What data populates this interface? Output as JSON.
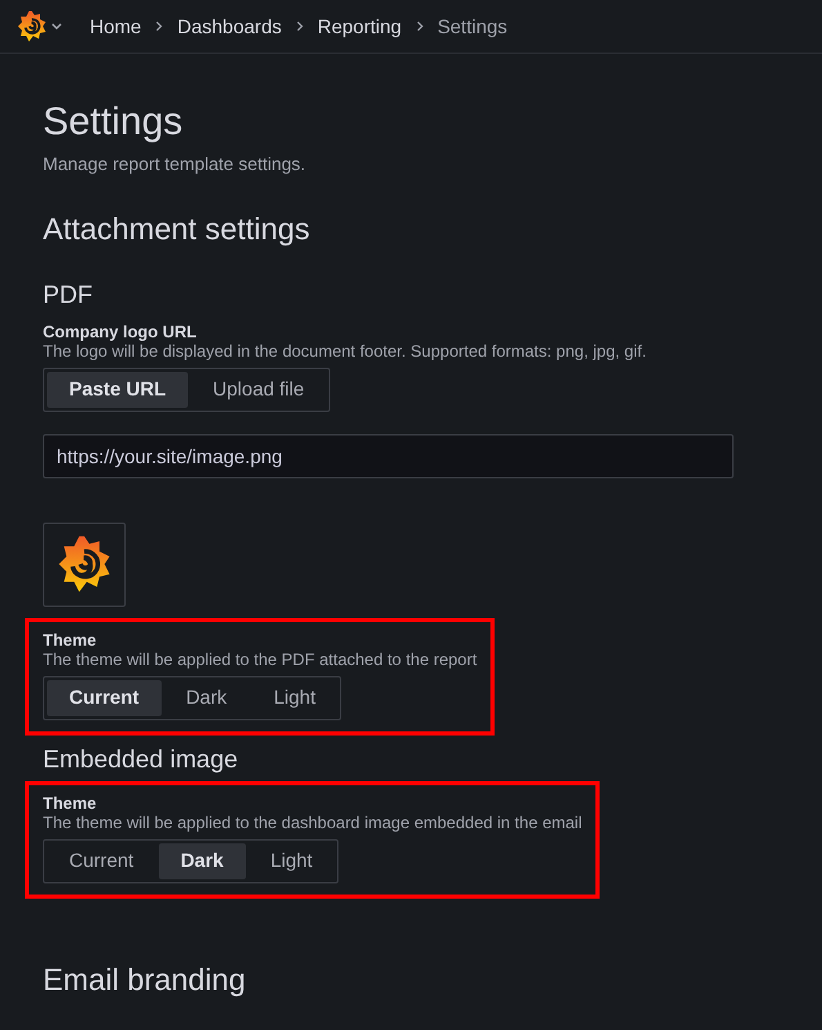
{
  "breadcrumbs": [
    {
      "label": "Home",
      "current": false
    },
    {
      "label": "Dashboards",
      "current": false
    },
    {
      "label": "Reporting",
      "current": false
    },
    {
      "label": "Settings",
      "current": true
    }
  ],
  "page": {
    "title": "Settings",
    "subtitle": "Manage report template settings."
  },
  "sections": [
    {
      "heading": "Attachment settings",
      "subheading": "PDF",
      "fields": [
        {
          "kind": "logo",
          "label": "Company logo URL",
          "description": "The logo will be displayed in the document footer. Supported formats: png, jpg, gif.",
          "options": [
            {
              "label": "Paste URL",
              "selected": true
            },
            {
              "label": "Upload file",
              "selected": false
            }
          ],
          "input": {
            "value": "https://your.site/image.png"
          }
        },
        {
          "kind": "theme",
          "highlighted": true,
          "label": "Theme",
          "description": "The theme will be applied to the PDF attached to the report",
          "options": [
            {
              "label": "Current",
              "selected": true
            },
            {
              "label": "Dark",
              "selected": false
            },
            {
              "label": "Light",
              "selected": false
            }
          ]
        }
      ]
    },
    {
      "subheading_large": "Embedded image",
      "fields": [
        {
          "kind": "theme",
          "highlighted": true,
          "label": "Theme",
          "description": "The theme will be applied to the dashboard image embedded in the email",
          "options": [
            {
              "label": "Current",
              "selected": false
            },
            {
              "label": "Dark",
              "selected": true
            },
            {
              "label": "Light",
              "selected": false
            }
          ]
        }
      ]
    },
    {
      "heading": "Email branding"
    }
  ]
}
